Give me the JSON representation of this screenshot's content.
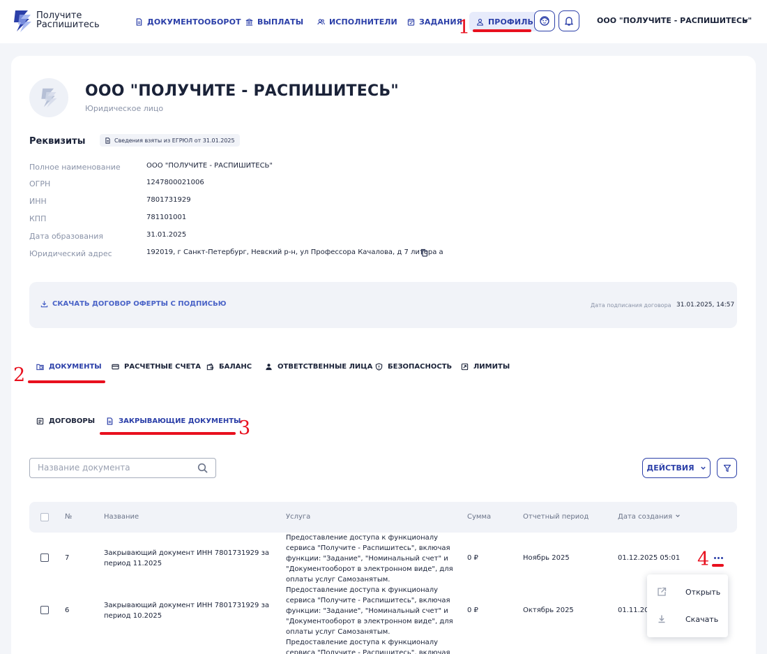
{
  "header": {
    "logo_line1": "Получите",
    "logo_line2": "Распишитесь",
    "nav": [
      {
        "label": "ДОКУМЕНТООБОРОТ",
        "icon": "document-icon"
      },
      {
        "label": "ВЫПЛАТЫ",
        "icon": "bank-icon"
      },
      {
        "label": "ИСПОЛНИТЕЛИ",
        "icon": "users-icon"
      },
      {
        "label": "ЗАДАНИЯ",
        "icon": "calendar-icon"
      },
      {
        "label": "ПРОФИЛЬ",
        "icon": "user-icon"
      }
    ],
    "org_name": "ООО \"ПОЛУЧИТЕ - РАСПИШИТЕСЬ\""
  },
  "profile": {
    "company_name": "ООО \"ПОЛУЧИТЕ - РАСПИШИТЕСЬ\"",
    "company_type": "Юридическое лицо"
  },
  "requisites": {
    "title": "Реквизиты",
    "badge": "Сведения взяты из ЕГРЮЛ от 31.01.2025",
    "fields": [
      {
        "label": "Полное наименование",
        "value": "ООО \"ПОЛУЧИТЕ - РАСПИШИТЕСЬ\""
      },
      {
        "label": "ОГРН",
        "value": "1247800021006"
      },
      {
        "label": "ИНН",
        "value": "7801731929"
      },
      {
        "label": "КПП",
        "value": "781101001"
      },
      {
        "label": "Дата образования",
        "value": "31.01.2025"
      },
      {
        "label": "Юридический адрес",
        "value": "192019, г Санкт-Петербург, Невский р-н, ул Профессора Качалова, д 7 литера а"
      }
    ]
  },
  "offer": {
    "link": "СКАЧАТЬ ДОГОВОР ОФЕРТЫ С ПОДПИСЬЮ",
    "sign_label": "Дата подписания договора",
    "sign_date": "31.01.2025, 14:57"
  },
  "tabs": [
    {
      "label": "ДОКУМЕНТЫ"
    },
    {
      "label": "РАСЧЕТНЫЕ СЧЕТА"
    },
    {
      "label": "БАЛАНС"
    },
    {
      "label": "ОТВЕТСТВЕННЫЕ ЛИЦА"
    },
    {
      "label": "БЕЗОПАСНОСТЬ"
    },
    {
      "label": "ЛИМИТЫ"
    }
  ],
  "subtabs": [
    {
      "label": "ДОГОВОРЫ"
    },
    {
      "label": "ЗАКРЫВАЮЩИЕ ДОКУМЕНТЫ"
    }
  ],
  "toolbar": {
    "search_placeholder": "Название документа",
    "actions_label": "ДЕЙСТВИЯ"
  },
  "table": {
    "columns": [
      "№",
      "Название",
      "Услуга",
      "Сумма",
      "Отчетный период",
      "Дата создания"
    ],
    "rows": [
      {
        "num": "7",
        "name_l1": "Закрывающий документ ИНН 7801731929 за",
        "name_l2": "период 11.2025",
        "service_l1": "Предоставление доступа к функционалу",
        "service_l2": "сервиса \"Получите - Распишитесь\", включая",
        "service_l3": "функции: \"Задание\", \"Номинальный счет\" и",
        "service_l4": "\"Документооборот в электронном виде\", для",
        "service_l5": "оплаты услуг Самозанятым.",
        "sum": "0 ₽",
        "period": "Ноябрь 2025",
        "created": "01.12.2025 05:01"
      },
      {
        "num": "6",
        "name_l1": "Закрывающий документ ИНН 7801731929 за",
        "name_l2": "период 10.2025",
        "service_l1": "Предоставление доступа к функционалу",
        "service_l2": "сервиса \"Получите - Распишитесь\", включая",
        "service_l3": "функции: \"Задание\", \"Номинальный счет\" и",
        "service_l4": "\"Документооборот в электронном виде\", для",
        "service_l5": "оплаты услуг Самозанятым.",
        "sum": "0 ₽",
        "period": "Октябрь 2025",
        "created": "01.11.2025 05:01"
      },
      {
        "service_l1": "Предоставление доступа к функционалу",
        "service_l2": "сервиса \"Получите - Распишитесь\", включая"
      }
    ]
  },
  "menu": {
    "open": "Открыть",
    "download": "Скачать"
  },
  "annotations": [
    "1",
    "2",
    "3",
    "4"
  ],
  "colors": {
    "accent": "#2b3fa8",
    "annotation_red": "#e8101e",
    "background": "#f3f5f9"
  }
}
